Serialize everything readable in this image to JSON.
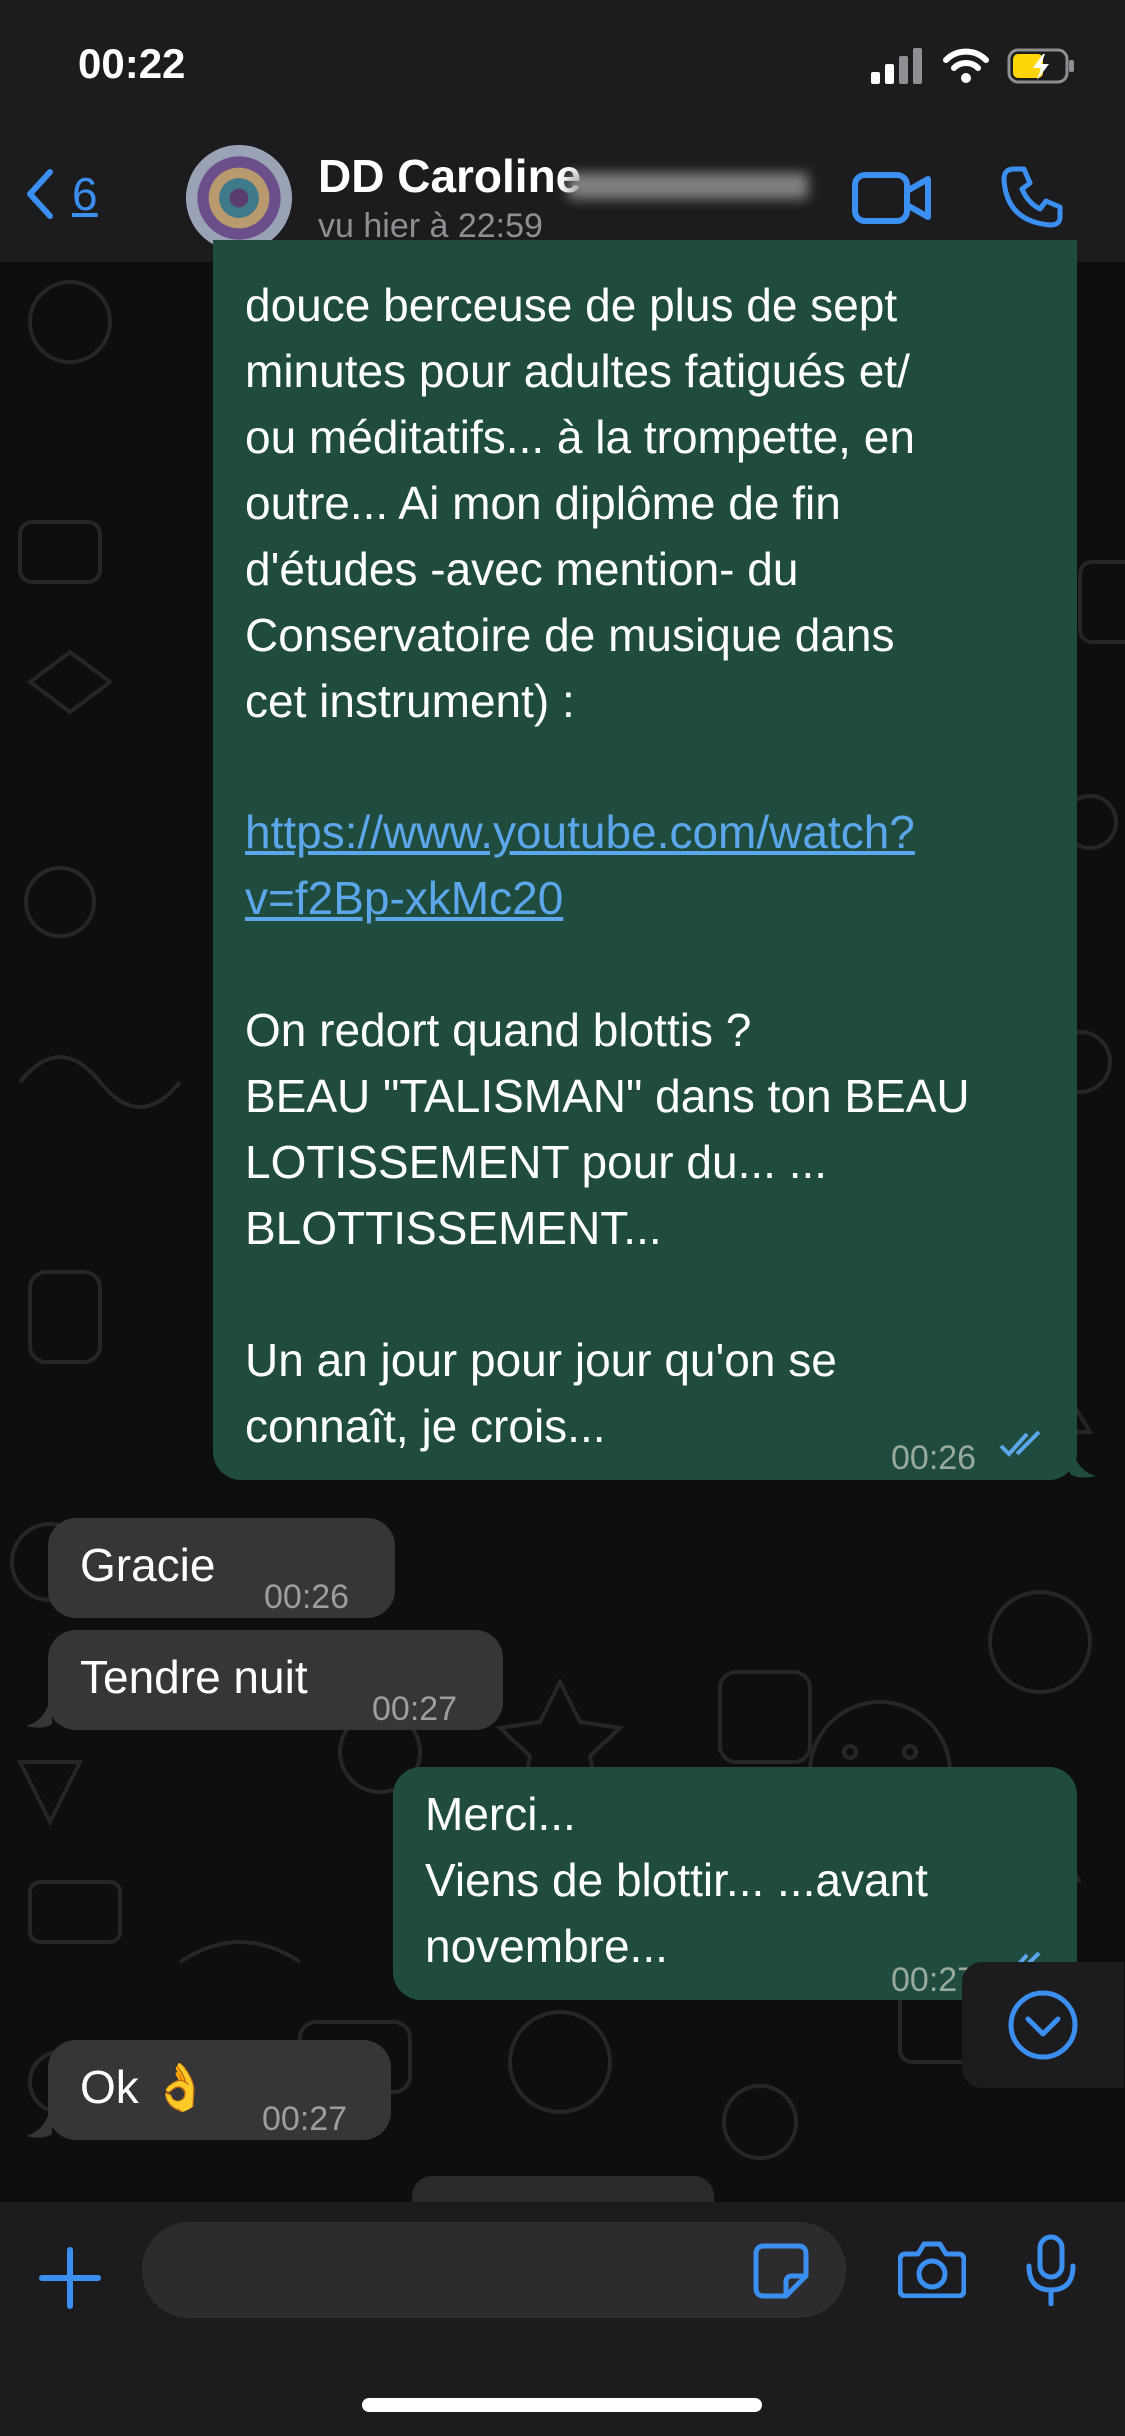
{
  "status_bar": {
    "time": "00:22"
  },
  "header": {
    "back_count": "6",
    "contact_name": "DD Caroline",
    "last_seen": "vu hier à 22:59"
  },
  "messages": [
    {
      "direction": "out",
      "text_before_link": "douce berceuse de plus de sept\nminutes pour adultes fatigués et/\nou méditatifs... à la trompette, en\noutre... Ai mon diplôme de fin\nd'études -avec mention- du\nConservatoire de musique dans\ncet instrument) :",
      "link": "https://www.youtube.com/watch?\nv=f2Bp-xkMc20",
      "text_after_link": "On redort quand blottis ?\nBEAU \"TALISMAN\" dans ton BEAU\nLOTISSEMENT pour du... ...\nBLOTTISSEMENT...\n\nUn an jour pour jour qu'on se\nconnaît, je crois...",
      "time": "00:26"
    },
    {
      "direction": "in",
      "text": "Gracie",
      "time": "00:26"
    },
    {
      "direction": "in",
      "text": "Tendre nuit",
      "time": "00:27"
    },
    {
      "direction": "out",
      "text": "Merci...\nViens de blottir... ...avant\nnovembre...",
      "time": "00:27"
    },
    {
      "direction": "in",
      "text": "Ok 👌",
      "time": "00:27"
    }
  ],
  "colors": {
    "accent": "#3b8ff0",
    "outgoing_bubble": "#1f4c3f",
    "incoming_bubble": "#363638",
    "link": "#5ba7ea"
  }
}
